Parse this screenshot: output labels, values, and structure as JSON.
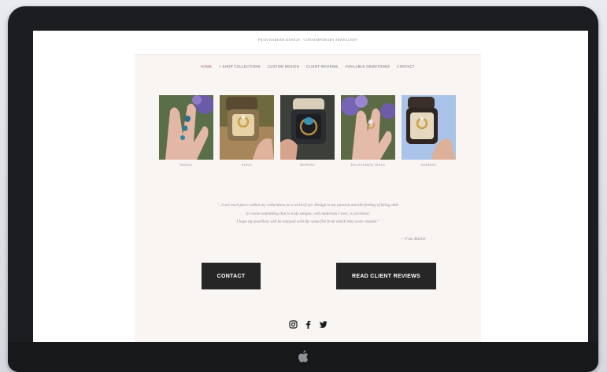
{
  "site": {
    "tagline": "FRAN BARKER DESIGN · CONTEMPORARY JEWELLERY"
  },
  "nav": {
    "items": [
      {
        "label": "HOME",
        "active": true
      },
      {
        "label": "+ SHOP COLLECTIONS",
        "active": false
      },
      {
        "label": "CUSTOM DESIGN",
        "active": false
      },
      {
        "label": "CLIENT REVIEWS",
        "active": false
      },
      {
        "label": "AVAILABLE GEMSTONES",
        "active": false
      },
      {
        "label": "CONTACT",
        "active": false
      }
    ]
  },
  "gallery": [
    {
      "caption": "BRIDAL"
    },
    {
      "caption": "RINGS"
    },
    {
      "caption": "BESPOKE"
    },
    {
      "caption": "ENGAGEMENT RINGS"
    },
    {
      "caption": "WEDDING"
    }
  ],
  "quote": {
    "line1": "\"...I see each piece within my collections as a work of art. Design is my passion and the feeling of being able",
    "line2": "to create something that is truly unique, with materials I love, is priceless!",
    "line3": "I hope my jewellery will be enjoyed with the same fire from which they were created.\"",
    "attribution": "— Fran Barker"
  },
  "buttons": {
    "contact": "CONTACT",
    "reviews": "READ CLIENT REVIEWS"
  },
  "social": [
    "instagram-icon",
    "facebook-icon",
    "twitter-icon"
  ],
  "colors": {
    "site_bg": "#f9f5f3",
    "button_bg": "#262626",
    "nav_active": "#a44a5a",
    "bezel": "#1c1d20"
  }
}
